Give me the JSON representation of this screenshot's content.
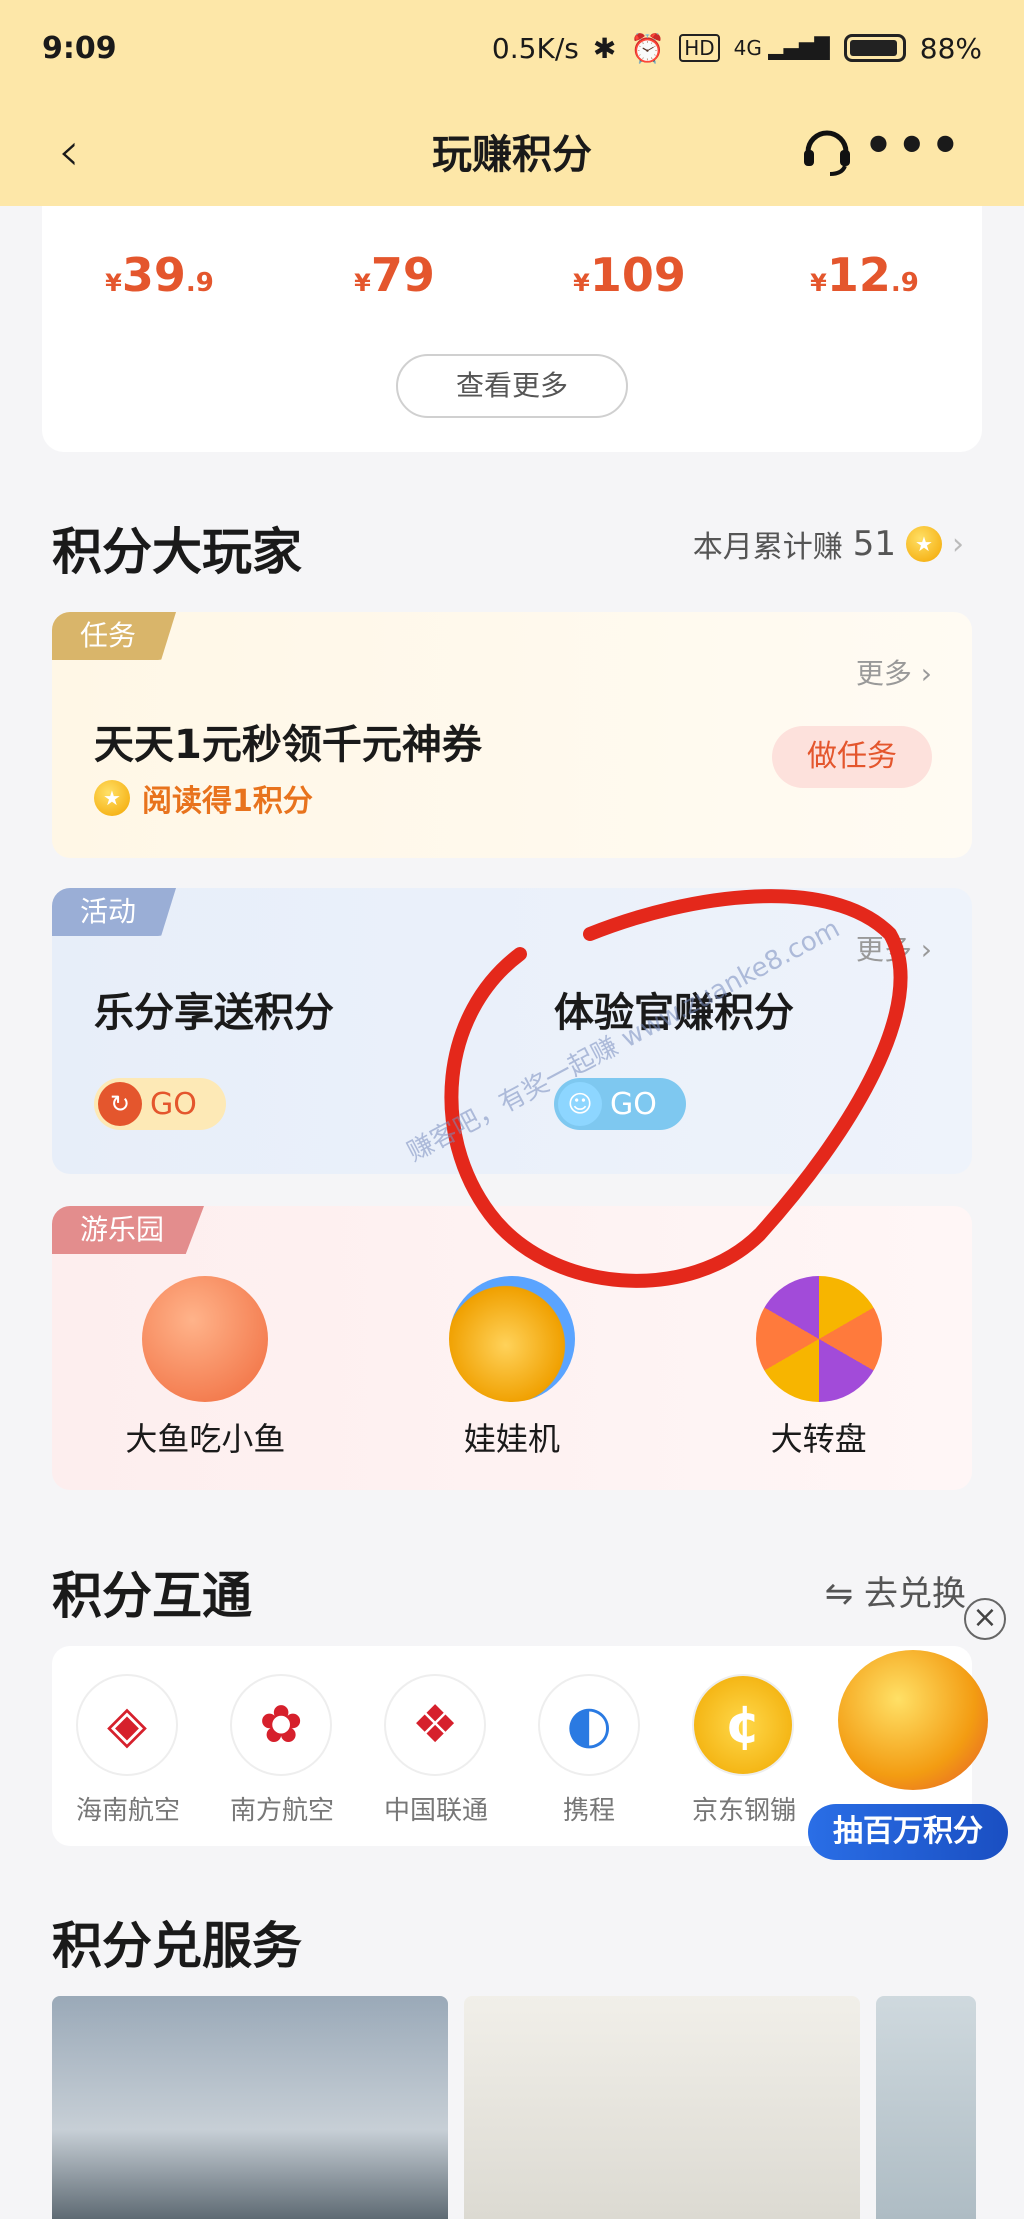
{
  "status": {
    "time": "9:09",
    "speed": "0.5K/s",
    "battery": "88%",
    "hd": "HD",
    "net": "4G"
  },
  "nav": {
    "title": "玩赚积分"
  },
  "products": {
    "prices": [
      {
        "int": "39",
        "dec": ".9"
      },
      {
        "int": "79",
        "dec": ""
      },
      {
        "int": "109",
        "dec": ""
      },
      {
        "int": "12",
        "dec": ".9"
      }
    ],
    "currency": "¥",
    "more_button": "查看更多"
  },
  "player": {
    "title": "积分大玩家",
    "monthly_label": "本月累计赚",
    "monthly_value": "51",
    "task": {
      "tag": "任务",
      "more": "更多 ›",
      "headline": "天天1元秒领千元神券",
      "reward": "阅读得1积分",
      "action": "做任务"
    },
    "activity": {
      "tag": "活动",
      "more": "更多 ›",
      "items": [
        {
          "name": "乐分享送积分",
          "go": "GO"
        },
        {
          "name": "体验官赚积分",
          "go": "GO"
        }
      ]
    },
    "playground": {
      "tag": "游乐园",
      "games": [
        "大鱼吃小鱼",
        "娃娃机",
        "大转盘"
      ]
    }
  },
  "exchange": {
    "title": "积分互通",
    "action": "⇋ 去兑换",
    "partners": [
      "海南航空",
      "南方航空",
      "中国联通",
      "携程",
      "京东钢镚"
    ]
  },
  "float_ad": {
    "label": "抽百万积分"
  },
  "service": {
    "title": "积分兑服务"
  },
  "watermark": "赚客吧，有奖一起赚 www.zuanke8.com",
  "colors": {
    "accent": "#e4562d",
    "nav_bg": "#fde7a8"
  }
}
